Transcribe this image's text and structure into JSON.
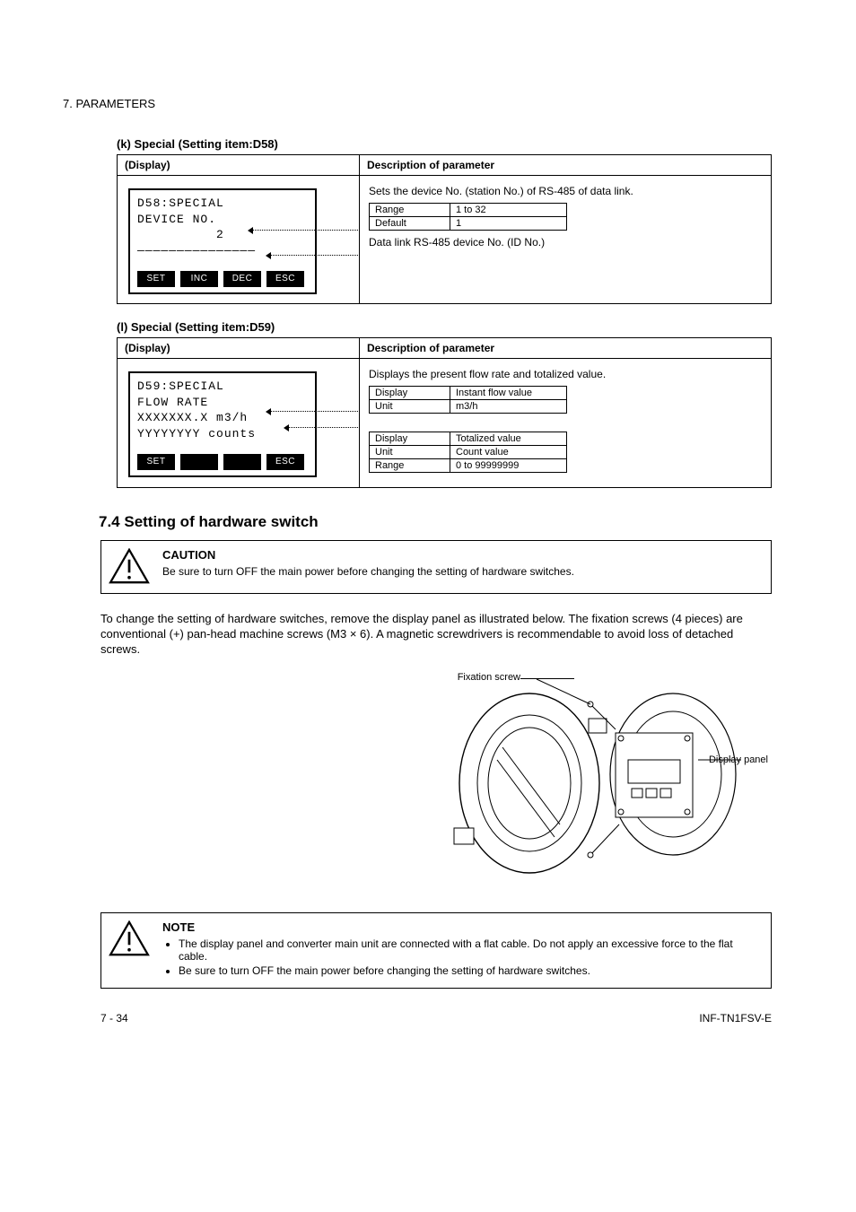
{
  "pageHeader": "7.  PARAMETERS",
  "section1": {
    "title": "(k) Special (Setting item:D58)",
    "tableHeader1": "(Display)",
    "tableHeader2": "Description of parameter",
    "lcd": {
      "l1": "D58:SPECIAL",
      "l2": "DEVICE NO.",
      "l3": "          2",
      "l4": "",
      "l5": "―――――――――――――――"
    },
    "softkeys": [
      "SET",
      "INC",
      "DEC",
      "ESC"
    ],
    "desc": "Sets the device No. (station No.) of RS-485 of data link.",
    "values": [
      {
        "k": "Range",
        "v": "1 to 32"
      },
      {
        "k": "Default",
        "v": "1"
      }
    ],
    "extra": "Data link RS-485 device No. (ID No.)"
  },
  "section2": {
    "title": "(l) Special (Setting item:D59)",
    "tableHeader1": "(Display)",
    "tableHeader2": "Description of parameter",
    "lcd": {
      "l1": "D59:SPECIAL",
      "l2": "FLOW RATE",
      "l3": "XXXXXXX.X m3/h",
      "l4": "YYYYYYYY counts",
      "l5": ""
    },
    "softkeys": [
      "SET",
      "",
      "",
      "ESC"
    ],
    "desc": "Displays the present flow rate and totalized value.",
    "valuesTop": [
      {
        "k": "Display",
        "v": "Instant flow value"
      },
      {
        "k": "Unit",
        "v": "m3/h"
      }
    ],
    "valuesBottom": [
      {
        "k": "Display",
        "v": "Totalized value"
      },
      {
        "k": "Unit",
        "v": "Count value"
      },
      {
        "k": "Range",
        "v": "0 to 99999999"
      }
    ]
  },
  "hwSwitchTitle": "7.4 Setting of hardware switch",
  "cautionBox": {
    "title": "CAUTION",
    "text": "Be sure to turn OFF the main power before changing the setting of hardware switches."
  },
  "para1": "To change the setting of hardware switches, remove the display panel as illustrated below. The fixation screws (4 pieces) are conventional (+) pan-head machine screws (M3 × 6). A magnetic screwdrivers is recommendable to avoid loss of detached screws.",
  "diagramLabels": {
    "fixScrew": "Fixation screw",
    "panel": "Display panel"
  },
  "noteBox": {
    "title": "NOTE",
    "items": [
      "The display panel and converter main unit are connected with a flat cable. Do not apply an excessive force to the flat cable.",
      "Be sure to turn OFF the main power before changing the setting of hardware switches."
    ]
  },
  "footer": {
    "left": "7 - 34",
    "right": "INF-TN1FSV-E"
  }
}
